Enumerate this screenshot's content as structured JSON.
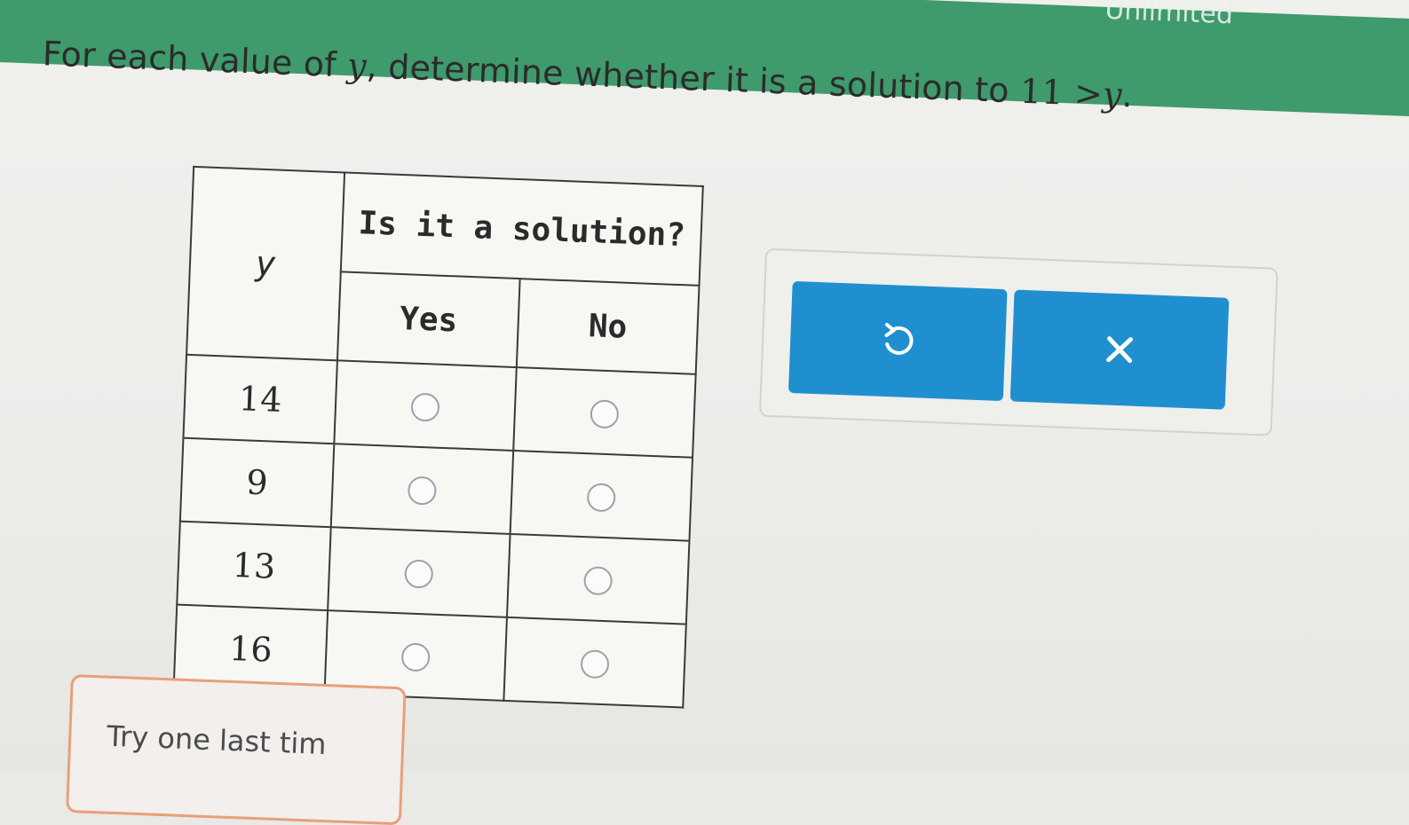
{
  "header": {
    "status_text": "Unlimited"
  },
  "question": {
    "prompt": "For each value of y, determine whether it is a solution to 11 > y.",
    "prompt_before": "For each value of ",
    "prompt_var": "y",
    "prompt_middle": ", determine whether it is a solution to ",
    "inequality_lhs": "11",
    "inequality_op": ">",
    "inequality_rhs": "y",
    "prompt_end": "."
  },
  "table": {
    "col_variable": "y",
    "col_group": "Is it a solution?",
    "col_yes": "Yes",
    "col_no": "No",
    "rows": [
      {
        "y": "14",
        "yes_selected": false,
        "no_selected": false
      },
      {
        "y": "9",
        "yes_selected": false,
        "no_selected": false
      },
      {
        "y": "13",
        "yes_selected": false,
        "no_selected": false
      },
      {
        "y": "16",
        "yes_selected": false,
        "no_selected": false
      }
    ]
  },
  "actions": {
    "undo_icon": "undo-icon",
    "clear_icon": "close-icon",
    "button_color": "#1f8fd0"
  },
  "feedback": {
    "text": "Try one last tim",
    "border_color": "#e7a079"
  },
  "colors": {
    "header_bar": "#3f9a6c"
  }
}
